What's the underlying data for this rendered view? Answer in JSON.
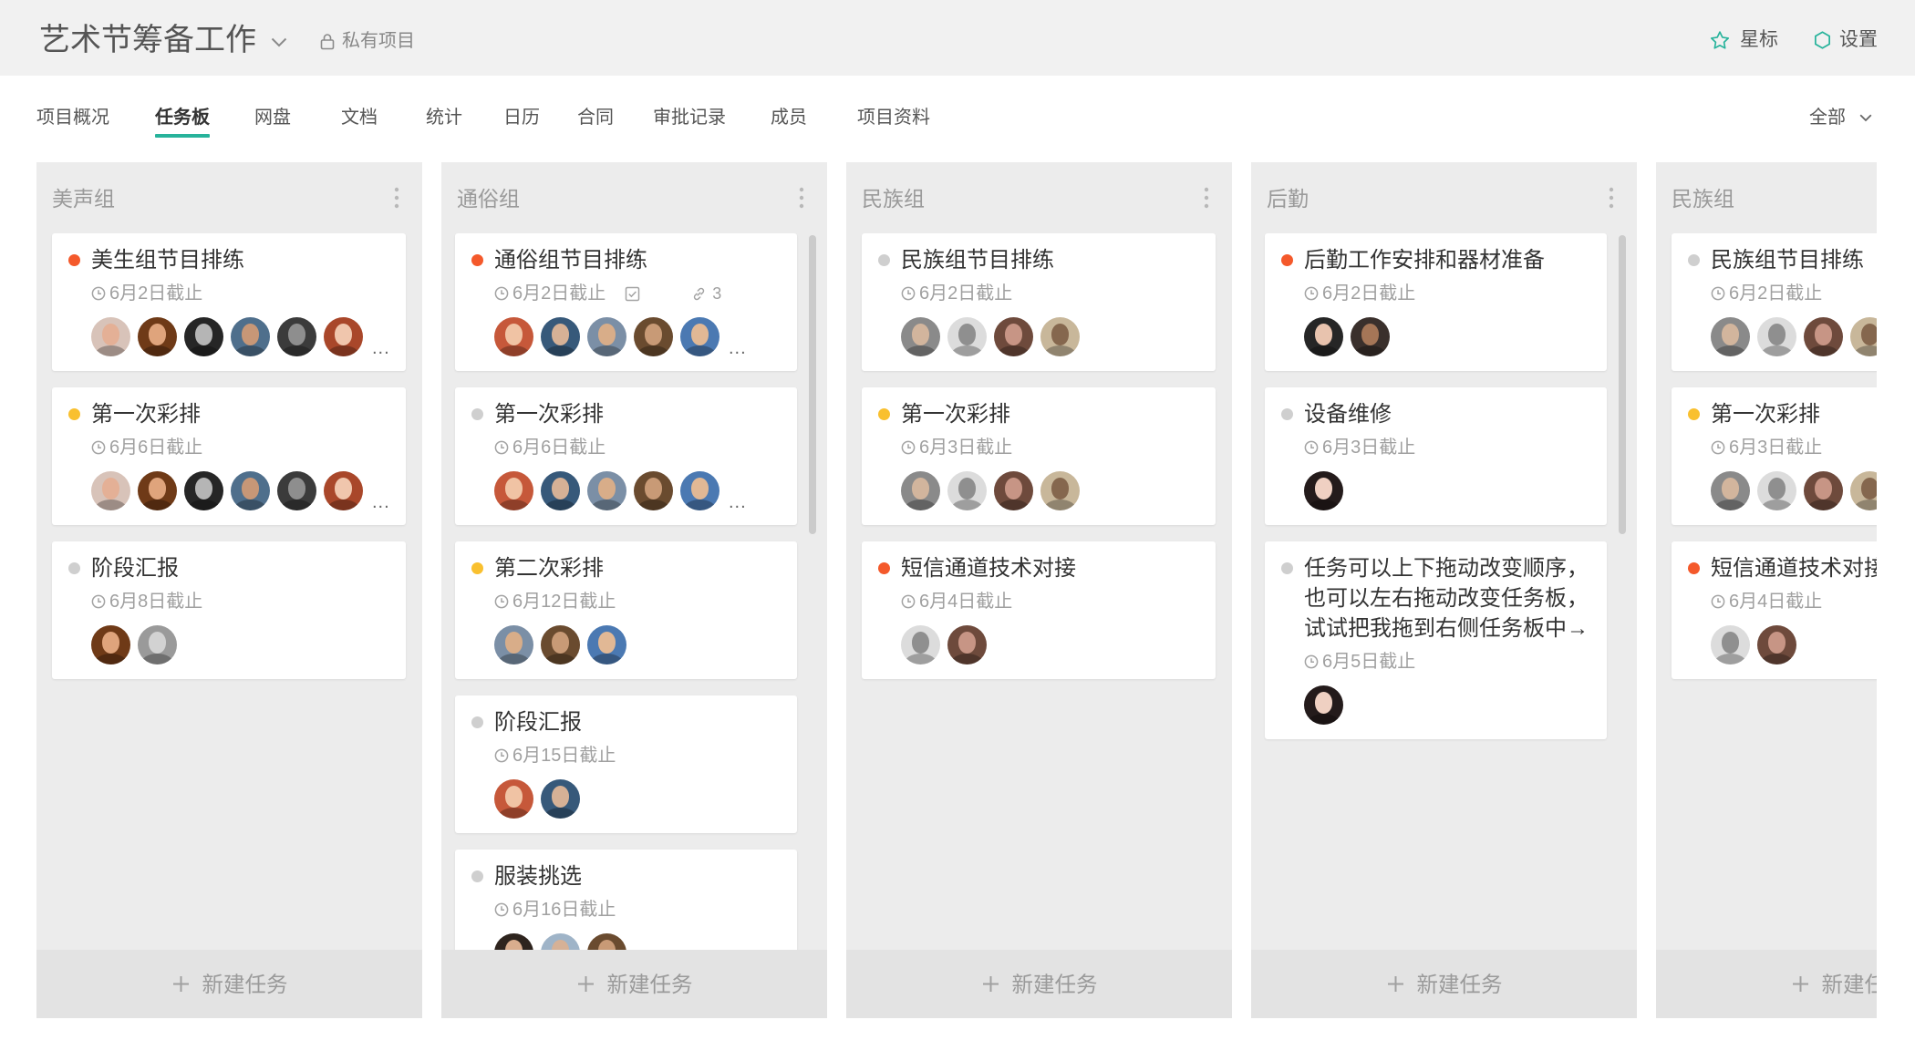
{
  "header": {
    "project_title": "艺术节筹备工作",
    "visibility_label": "私有项目",
    "star_label": "星标",
    "settings_label": "设置"
  },
  "tabs": [
    {
      "label": "项目概况"
    },
    {
      "label": "任务板",
      "active": true
    },
    {
      "label": "网盘"
    },
    {
      "label": "文档"
    },
    {
      "label": "统计"
    },
    {
      "label": "日历"
    },
    {
      "label": "合同"
    },
    {
      "label": "审批记录"
    },
    {
      "label": "成员"
    },
    {
      "label": "项目资料"
    }
  ],
  "filter": {
    "label": "全部"
  },
  "colors": {
    "accent": "#27b39b",
    "dot_red": "#f4592b",
    "dot_yellow": "#f9c02f",
    "dot_gray": "#cfcfcf"
  },
  "columns": [
    {
      "title": "美声组",
      "scrollbar": false,
      "new_task_label": "新建任务",
      "cards": [
        {
          "title": "美生组节目排练",
          "dot_color": "#f4592b",
          "due": "6月2日截止",
          "avatars": [
            [
              "#d8c3b9",
              "#e4b096"
            ],
            [
              "#6f3a17",
              "#dfa47c"
            ],
            [
              "#262626",
              "#b5b5b5"
            ],
            [
              "#4f6f8c",
              "#c79777"
            ],
            [
              "#3b3b3b",
              "#8e8e8e"
            ],
            [
              "#a9472a",
              "#f0c6ad"
            ]
          ],
          "more": "..."
        },
        {
          "title": "第一次彩排",
          "dot_color": "#f9c02f",
          "due": "6月6日截止",
          "avatars": [
            [
              "#d8c3b9",
              "#e4b096"
            ],
            [
              "#6f3a17",
              "#dfa47c"
            ],
            [
              "#262626",
              "#b5b5b5"
            ],
            [
              "#4f6f8c",
              "#c79777"
            ],
            [
              "#3b3b3b",
              "#8e8e8e"
            ],
            [
              "#a9472a",
              "#f0c6ad"
            ]
          ],
          "more": "..."
        },
        {
          "title": "阶段汇报",
          "dot_color": "#cfcfcf",
          "due": "6月8日截止",
          "avatars": [
            [
              "#6f3a17",
              "#dfa47c"
            ],
            [
              "#9a9a9a",
              "#d2d2d2"
            ]
          ]
        }
      ]
    },
    {
      "title": "通俗组",
      "scrollbar": true,
      "new_task_label": "新建任务",
      "cards": [
        {
          "title": "通俗组节目排练",
          "dot_color": "#f4592b",
          "due": "6月2日截止",
          "checklist_icon": "checkbox-icon",
          "link_icon": "link-icon",
          "link_count": "3",
          "avatars": [
            [
              "#c6583a",
              "#f0c3a4"
            ],
            [
              "#37597a",
              "#d6b196"
            ],
            [
              "#7b8fa6",
              "#d8ad89"
            ],
            [
              "#6a4b2f",
              "#c89a76"
            ],
            [
              "#4b79b2",
              "#e1b895"
            ]
          ],
          "more": "..."
        },
        {
          "title": "第一次彩排",
          "dot_color": "#cfcfcf",
          "due": "6月6日截止",
          "avatars": [
            [
              "#c6583a",
              "#f0c3a4"
            ],
            [
              "#37597a",
              "#d6b196"
            ],
            [
              "#7b8fa6",
              "#d8ad89"
            ],
            [
              "#6a4b2f",
              "#c89a76"
            ],
            [
              "#4b79b2",
              "#e1b895"
            ]
          ],
          "more": "..."
        },
        {
          "title": "第二次彩排",
          "dot_color": "#f9c02f",
          "due": "6月12日截止",
          "avatars": [
            [
              "#7b8fa6",
              "#d8ad89"
            ],
            [
              "#6a4b2f",
              "#c89a76"
            ],
            [
              "#4b79b2",
              "#e1b895"
            ]
          ]
        },
        {
          "title": "阶段汇报",
          "dot_color": "#cfcfcf",
          "due": "6月15日截止",
          "avatars": [
            [
              "#c6583a",
              "#f0c3a4"
            ],
            [
              "#37597a",
              "#d6b196"
            ]
          ]
        },
        {
          "title": "服装挑选",
          "dot_color": "#cfcfcf",
          "due": "6月16日截止",
          "avatars": [
            [
              "#2e241e",
              "#d9ad8e"
            ],
            [
              "#9fb4c8",
              "#d6b196"
            ],
            [
              "#6a4b2f",
              "#c89a76"
            ]
          ]
        }
      ]
    },
    {
      "title": "民族组",
      "scrollbar": false,
      "new_task_label": "新建任务",
      "cards": [
        {
          "title": "民族组节目排练",
          "dot_color": "#cfcfcf",
          "due": "6月2日截止",
          "avatars": [
            [
              "#8a8a8a",
              "#d2b59d"
            ],
            [
              "#dcdcdc",
              "#8f8f8f"
            ],
            [
              "#6e4a3c",
              "#c79585"
            ],
            [
              "#c8b79a",
              "#85674e"
            ]
          ]
        },
        {
          "title": "第一次彩排",
          "dot_color": "#f9c02f",
          "due": "6月3日截止",
          "avatars": [
            [
              "#8a8a8a",
              "#d2b59d"
            ],
            [
              "#dcdcdc",
              "#8f8f8f"
            ],
            [
              "#6e4a3c",
              "#c79585"
            ],
            [
              "#c8b79a",
              "#85674e"
            ]
          ]
        },
        {
          "title": "短信通道技术对接",
          "dot_color": "#f4592b",
          "due": "6月4日截止",
          "avatars": [
            [
              "#dcdcdc",
              "#8f8f8f"
            ],
            [
              "#6e4a3c",
              "#c79585"
            ]
          ]
        }
      ]
    },
    {
      "title": "后勤",
      "scrollbar": true,
      "new_task_label": "新建任务",
      "cards": [
        {
          "title": "后勤工作安排和器材准备",
          "dot_color": "#f4592b",
          "due": "6月2日截止",
          "avatars": [
            [
              "#262626",
              "#e8c3ae"
            ],
            [
              "#3a302c",
              "#a57657"
            ]
          ]
        },
        {
          "title": "设备维修",
          "dot_color": "#cfcfcf",
          "due": "6月3日截止",
          "avatars": [
            [
              "#241b1b",
              "#efd0c2"
            ]
          ]
        },
        {
          "title": "任务可以上下拖动改变顺序，也可以左右拖动改变任务板，试试把我拖到右侧任务板中→",
          "dot_color": "#cfcfcf",
          "due": "6月5日截止",
          "avatars": [
            [
              "#241b1b",
              "#efd0c2"
            ]
          ]
        }
      ]
    },
    {
      "title": "民族组",
      "scrollbar": false,
      "new_task_label": "新建任务",
      "cards": [
        {
          "title": "民族组节目排练",
          "dot_color": "#cfcfcf",
          "due": "6月2日截止",
          "avatars": [
            [
              "#8a8a8a",
              "#d2b59d"
            ],
            [
              "#dcdcdc",
              "#8f8f8f"
            ],
            [
              "#6e4a3c",
              "#c79585"
            ],
            [
              "#c8b79a",
              "#85674e"
            ]
          ]
        },
        {
          "title": "第一次彩排",
          "dot_color": "#f9c02f",
          "due": "6月3日截止",
          "avatars": [
            [
              "#8a8a8a",
              "#d2b59d"
            ],
            [
              "#dcdcdc",
              "#8f8f8f"
            ],
            [
              "#6e4a3c",
              "#c79585"
            ],
            [
              "#c8b79a",
              "#85674e"
            ]
          ]
        },
        {
          "title": "短信通道技术对接",
          "dot_color": "#f4592b",
          "due": "6月4日截止",
          "avatars": [
            [
              "#dcdcdc",
              "#8f8f8f"
            ],
            [
              "#6e4a3c",
              "#c79585"
            ]
          ]
        }
      ]
    }
  ]
}
